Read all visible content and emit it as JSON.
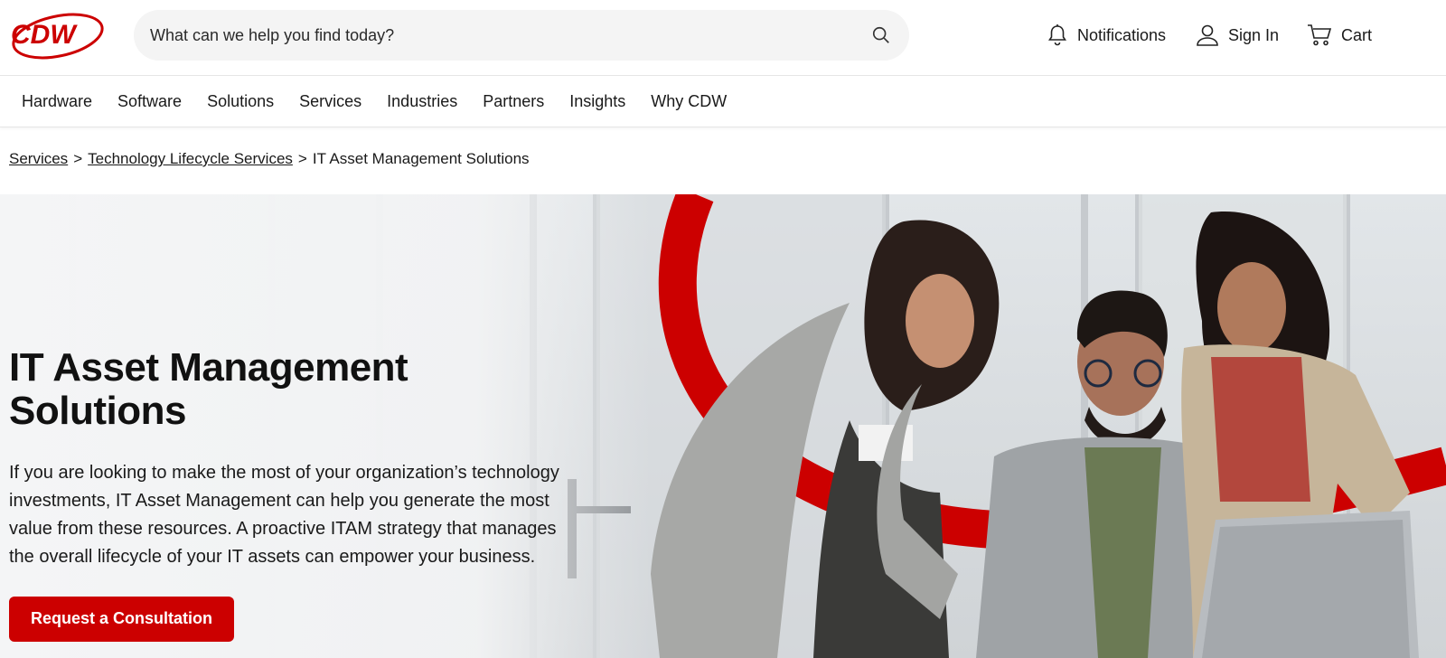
{
  "brand": {
    "logo_text": "CDW",
    "accent_color": "#cc0000"
  },
  "search": {
    "placeholder": "What can we help you find today?",
    "value": ""
  },
  "utility": {
    "notifications_label": "Notifications",
    "signin_label": "Sign In",
    "cart_label": "Cart"
  },
  "nav": {
    "items": [
      {
        "label": "Hardware"
      },
      {
        "label": "Software"
      },
      {
        "label": "Solutions"
      },
      {
        "label": "Services"
      },
      {
        "label": "Industries"
      },
      {
        "label": "Partners"
      },
      {
        "label": "Insights"
      },
      {
        "label": "Why CDW"
      }
    ]
  },
  "breadcrumb": {
    "items": [
      {
        "label": "Services"
      },
      {
        "label": "Technology Lifecycle Services"
      },
      {
        "label": "IT Asset Management Solutions"
      }
    ],
    "separator": ">"
  },
  "hero": {
    "title": "IT Asset Management Solutions",
    "body": "If you are looking to make the most of your organization’s technology investments, IT Asset Management can help you generate the most value from these resources. A proactive ITAM strategy that manages the overall lifecycle of your IT assets can empower your business.",
    "cta_label": "Request a Consultation"
  },
  "icons": {
    "search": "search-icon",
    "notifications": "bell-icon",
    "signin": "user-icon",
    "cart": "cart-icon"
  }
}
